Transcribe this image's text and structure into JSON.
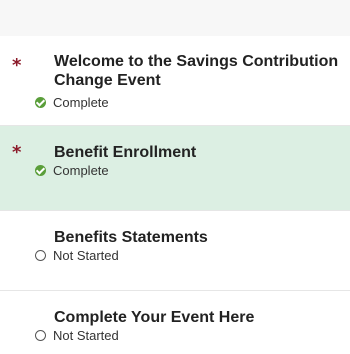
{
  "steps": [
    {
      "title": "Welcome to the Savings Contribution Change Event",
      "required": "*",
      "status": "Complete"
    },
    {
      "title": "Benefit Enrollment",
      "required": "*",
      "status": "Complete"
    },
    {
      "title": "Benefits Statements",
      "status": "Not Started"
    },
    {
      "title": "Complete Your Event Here",
      "status": "Not Started"
    }
  ],
  "colors": {
    "active_background": "#dcefe3",
    "required_marker": "#8b1a2a",
    "complete_icon": "#5a9e3a"
  }
}
